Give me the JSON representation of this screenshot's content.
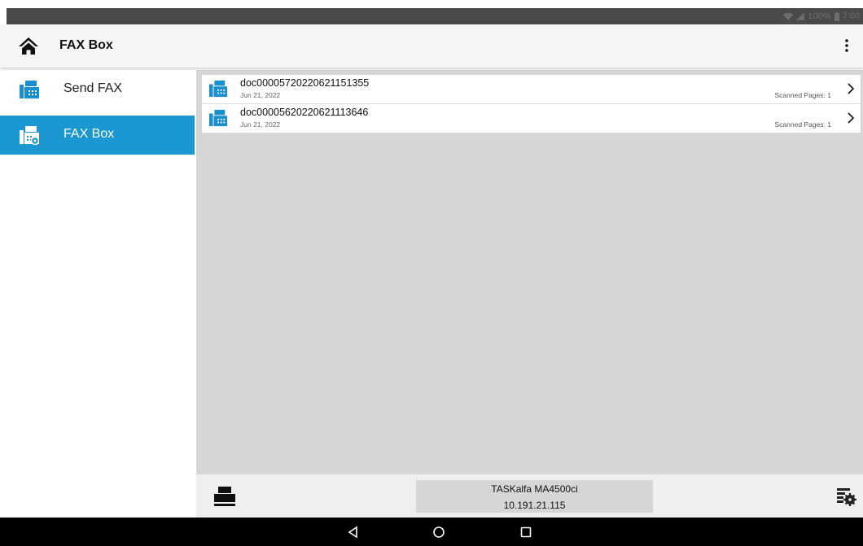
{
  "status_bar": {
    "battery_text": "100%",
    "time": "7:00"
  },
  "app_bar": {
    "title": "FAX Box",
    "home_icon": "home-icon",
    "overflow_icon": "more-vert-icon"
  },
  "sidebar": {
    "items": [
      {
        "label": "Send FAX",
        "icon": "fax-icon",
        "selected": false
      },
      {
        "label": "FAX Box",
        "icon": "fax-box-icon",
        "selected": true
      }
    ]
  },
  "list": {
    "rows": [
      {
        "name": "doc00005720220621151355",
        "date": "Jun 21, 2022",
        "pages": "Scanned Pages: 1"
      },
      {
        "name": "doc00005620220621113646",
        "date": "Jun 21, 2022",
        "pages": "Scanned Pages: 1"
      }
    ]
  },
  "bottom_bar": {
    "device_name": "TASKalfa MA4500ci",
    "device_ip": "10.191.21.115",
    "printer_icon": "printer-icon",
    "settings_icon": "device-settings-icon"
  },
  "android_nav": {
    "back_icon": "back-icon",
    "home_icon": "home-circle-icon",
    "recents_icon": "recents-icon"
  },
  "colors": {
    "accent": "#1b98d2",
    "status_bar": "#4a4a4a",
    "list_background": "#d6d6d6",
    "icon_blue": "#1a8fd0"
  }
}
